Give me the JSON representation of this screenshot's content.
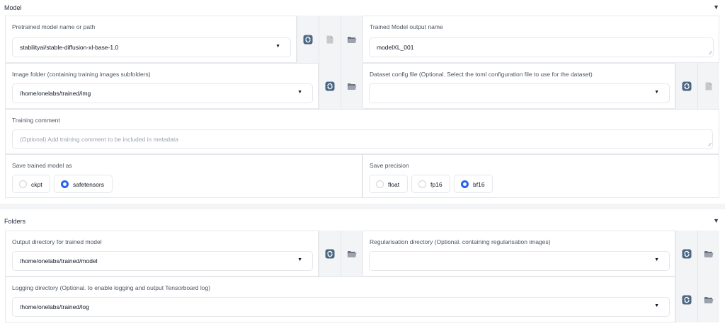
{
  "model": {
    "title": "Model",
    "arrow": "▼",
    "pretrained": {
      "label": "Pretrained model name or path",
      "value": "stabilityai/stable-diffusion-xl-base-1.0"
    },
    "output_name": {
      "label": "Trained Model output name",
      "value": "modelXL_001"
    },
    "image_folder": {
      "label": "Image folder (containing training images subfolders)",
      "value": "/home/onelabs/trained/img"
    },
    "dataset_config": {
      "label": "Dataset config file (Optional. Select the toml configuration file to use for the dataset)",
      "value": ""
    },
    "training_comment": {
      "label": "Training comment",
      "placeholder": "(Optional) Add training comment to be included in metadata"
    },
    "save_as": {
      "label": "Save trained model as",
      "options": [
        "ckpt",
        "safetensors"
      ],
      "selected": "safetensors"
    },
    "save_precision": {
      "label": "Save precision",
      "options": [
        "float",
        "fp16",
        "bf16"
      ],
      "selected": "bf16"
    }
  },
  "folders": {
    "title": "Folders",
    "arrow": "▼",
    "output_dir": {
      "label": "Output directory for trained model",
      "value": "/home/onelabs/trained/model"
    },
    "reg_dir": {
      "label": "Regularisation directory (Optional. containing regularisation images)",
      "value": ""
    },
    "logging_dir": {
      "label": "Logging directory (Optional. to enable logging and output Tensorboard log)",
      "value": "/home/onelabs/trained/log"
    }
  },
  "icons": {
    "refresh": "refresh-icon",
    "file": "file-icon",
    "folder": "folder-icon"
  },
  "colors": {
    "accent": "#2563eb",
    "refresh_icon": "#4b6784",
    "button_bg": "#f3f4f6",
    "border": "#e5e7eb"
  }
}
